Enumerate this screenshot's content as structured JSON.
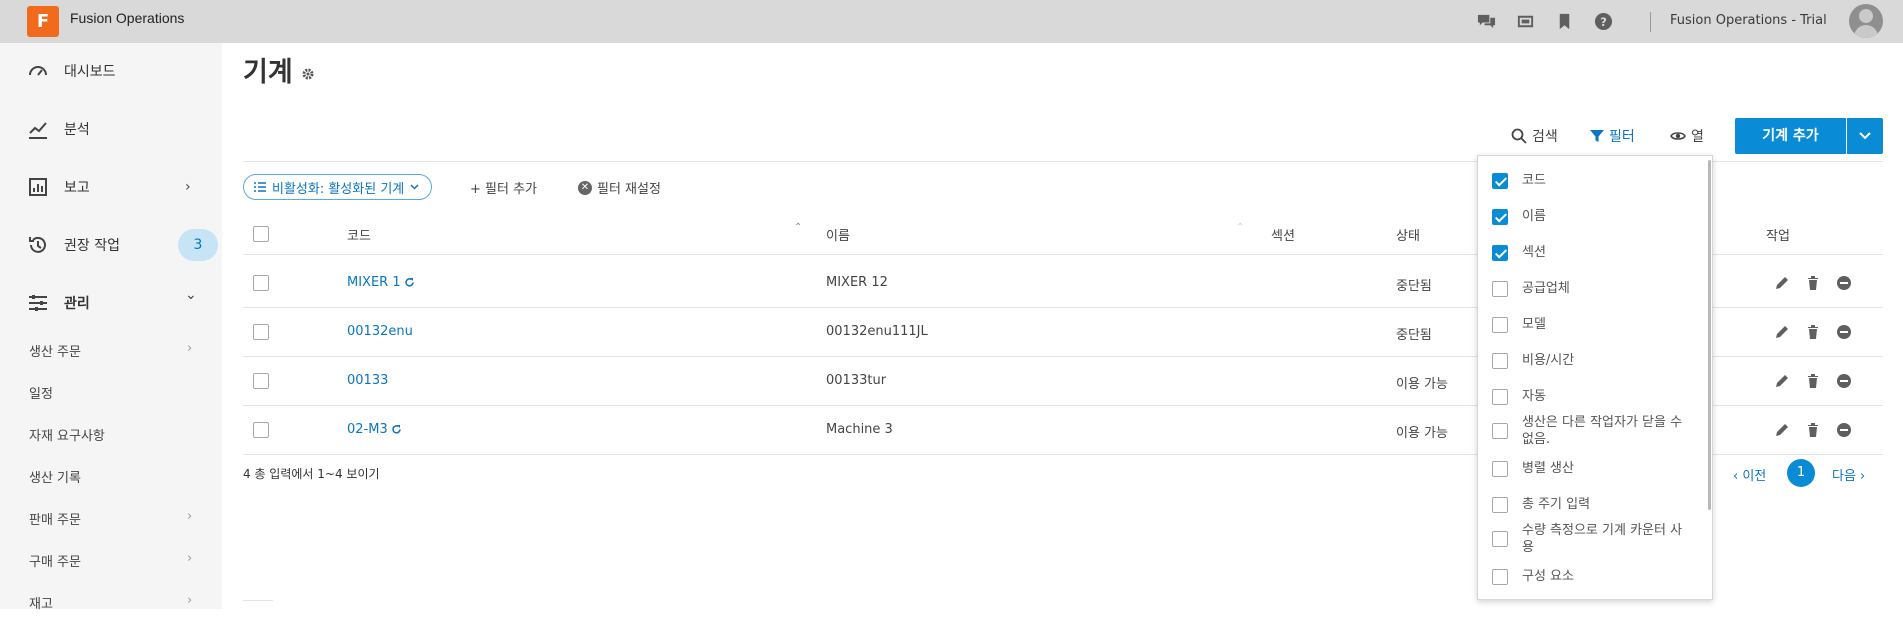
{
  "app": {
    "logo_letter": "F",
    "name": "Fusion Operations",
    "trial_label": "Fusion Operations - Trial"
  },
  "topbar_icons": [
    "chat-icon",
    "video-icon",
    "bookmark-icon",
    "help-icon"
  ],
  "sidebar": {
    "items": [
      {
        "label": "대시보드",
        "icon": "dashboard-icon"
      },
      {
        "label": "분석",
        "icon": "analytics-icon"
      },
      {
        "label": "보고",
        "icon": "report-icon",
        "chevron": "›"
      },
      {
        "label": "권장 작업",
        "icon": "history-icon",
        "badge": "3"
      },
      {
        "label": "관리",
        "icon": "sliders-icon",
        "chevron": "⌄"
      }
    ],
    "sub_items": [
      {
        "label": "생산 주문",
        "chevron": "›"
      },
      {
        "label": "일정"
      },
      {
        "label": "자재 요구사항"
      },
      {
        "label": "생산 기록"
      },
      {
        "label": "판매 주문",
        "chevron": "›"
      },
      {
        "label": "구매 주문",
        "chevron": "›"
      },
      {
        "label": "재고",
        "chevron": "›"
      }
    ]
  },
  "page": {
    "title": "기계"
  },
  "toolbar": {
    "search_label": "검색",
    "filter_label": "필터",
    "columns_label": "열",
    "add_label": "기계 추가"
  },
  "filters": {
    "chip_label": "비활성화: 활성화된 기계",
    "add_filter_label": "+ 필터 추가",
    "reset_label": "필터 재설정"
  },
  "table": {
    "headers": {
      "code": "코드",
      "name": "이름",
      "section": "섹션",
      "status": "상태",
      "actions": "작업"
    },
    "rows": [
      {
        "code": "MIXER 1",
        "refresh": true,
        "name": "MIXER 12",
        "status": "중단됨"
      },
      {
        "code": "00132enu",
        "refresh": false,
        "name": "00132enu111JL",
        "status": "중단됨"
      },
      {
        "code": "00133",
        "refresh": false,
        "name": "00133tur",
        "status": "이용 가능"
      },
      {
        "code": "02-M3",
        "refresh": true,
        "name": "Machine 3",
        "status": "이용 가능"
      }
    ]
  },
  "footer": {
    "summary": "4 총 입력에서 1~4 보이기",
    "prev_label": "‹ 이전",
    "current_page": "1",
    "next_label": "다음 ›"
  },
  "column_menu": {
    "items": [
      {
        "label": "코드",
        "checked": true
      },
      {
        "label": "이름",
        "checked": true
      },
      {
        "label": "섹션",
        "checked": true
      },
      {
        "label": "공급업체",
        "checked": false
      },
      {
        "label": "모델",
        "checked": false
      },
      {
        "label": "비용/시간",
        "checked": false
      },
      {
        "label": "자동",
        "checked": false
      },
      {
        "label": "생산은 다른 작업자가 닫을 수 없음.",
        "checked": false
      },
      {
        "label": "병렬 생산",
        "checked": false
      },
      {
        "label": "총 주기 입력",
        "checked": false
      },
      {
        "label": "수량 측정으로 기계 카운터 사용",
        "checked": false
      },
      {
        "label": "구성 요소",
        "checked": false
      }
    ]
  }
}
